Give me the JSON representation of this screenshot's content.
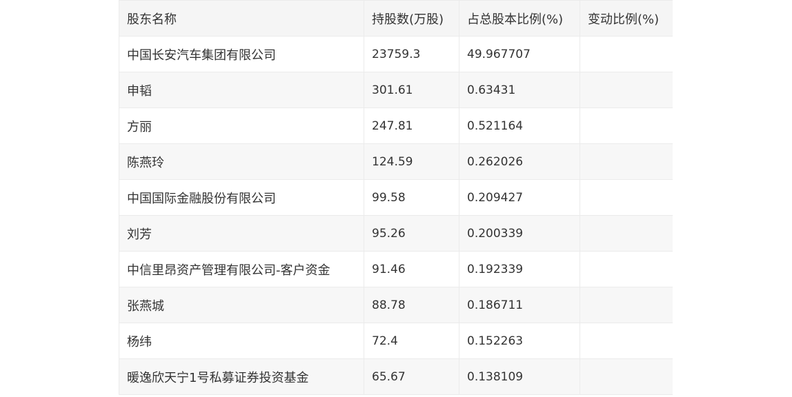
{
  "table": {
    "headers": [
      "股东名称",
      "持股数(万股)",
      "占总股本比例(%)",
      "变动比例(%)"
    ],
    "rows": [
      {
        "name": "中国长安汽车集团有限公司",
        "shares": "23759.3",
        "ratio": "49.967707",
        "change": ""
      },
      {
        "name": "申韬",
        "shares": "301.61",
        "ratio": "0.63431",
        "change": ""
      },
      {
        "name": "方丽",
        "shares": "247.81",
        "ratio": "0.521164",
        "change": ""
      },
      {
        "name": "陈燕玲",
        "shares": "124.59",
        "ratio": "0.262026",
        "change": ""
      },
      {
        "name": "中国国际金融股份有限公司",
        "shares": "99.58",
        "ratio": "0.209427",
        "change": ""
      },
      {
        "name": "刘芳",
        "shares": "95.26",
        "ratio": "0.200339",
        "change": ""
      },
      {
        "name": "中信里昂资产管理有限公司-客户资金",
        "shares": "91.46",
        "ratio": "0.192339",
        "change": ""
      },
      {
        "name": "张燕城",
        "shares": "88.78",
        "ratio": "0.186711",
        "change": ""
      },
      {
        "name": "杨纬",
        "shares": "72.4",
        "ratio": "0.152263",
        "change": ""
      },
      {
        "name": "暖逸欣天宁1号私募证券投资基金",
        "shares": "65.67",
        "ratio": "0.138109",
        "change": ""
      }
    ]
  }
}
